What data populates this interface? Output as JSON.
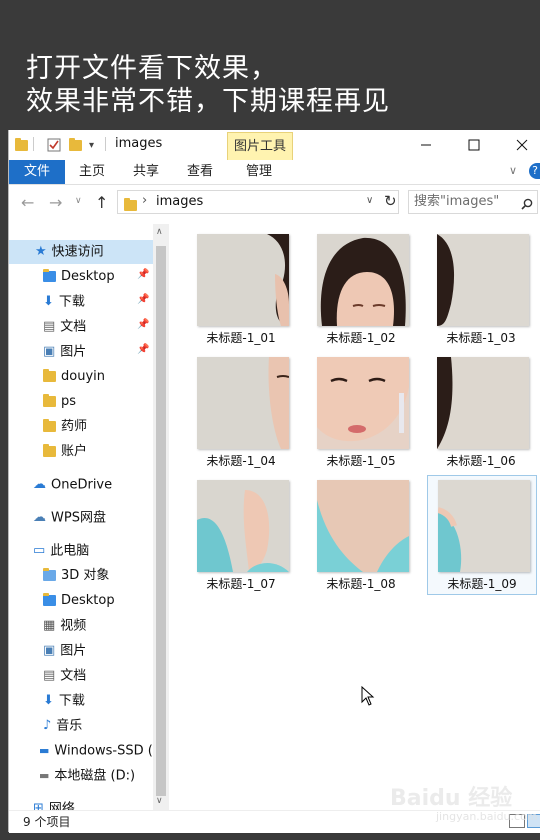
{
  "caption": {
    "line1": "打开文件看下效果，",
    "line2": "效果非常不错，下期课程再见"
  },
  "window": {
    "title": "images",
    "tabs": [
      "文件",
      "主页",
      "共享",
      "查看",
      "管理"
    ],
    "picture_tools_label": "图片工具",
    "help_label": "?"
  },
  "address": {
    "path": "images",
    "search_placeholder": "搜索\"images\""
  },
  "sidebar": {
    "quick_access": "快速访问",
    "quick_items": [
      {
        "label": "Desktop"
      },
      {
        "label": "下载"
      },
      {
        "label": "文档"
      },
      {
        "label": "图片"
      },
      {
        "label": "douyin"
      },
      {
        "label": "ps"
      },
      {
        "label": "药师"
      },
      {
        "label": "账户"
      }
    ],
    "onedrive": "OneDrive",
    "wps": "WPS网盘",
    "this_pc": "此电脑",
    "pc_items": [
      {
        "label": "3D 对象"
      },
      {
        "label": "Desktop"
      },
      {
        "label": "视频"
      },
      {
        "label": "图片"
      },
      {
        "label": "文档"
      },
      {
        "label": "下载"
      },
      {
        "label": "音乐"
      },
      {
        "label": "Windows-SSD ("
      },
      {
        "label": "本地磁盘 (D:)"
      }
    ],
    "network": "网络"
  },
  "files": [
    {
      "name": "未标题-1_01"
    },
    {
      "name": "未标题-1_02"
    },
    {
      "name": "未标题-1_03"
    },
    {
      "name": "未标题-1_04"
    },
    {
      "name": "未标题-1_05"
    },
    {
      "name": "未标题-1_06"
    },
    {
      "name": "未标题-1_07"
    },
    {
      "name": "未标题-1_08"
    },
    {
      "name": "未标题-1_09"
    }
  ],
  "status": {
    "count": "9 个项目"
  },
  "watermark": {
    "brand": "Baidu 经验",
    "url": "jingyan.baidu.com"
  },
  "colors": {
    "file_tab": "#1e6fc8",
    "picture_tools": "#fff3b0",
    "selection": "#9fc9e8",
    "folder": "#e8b93b"
  }
}
